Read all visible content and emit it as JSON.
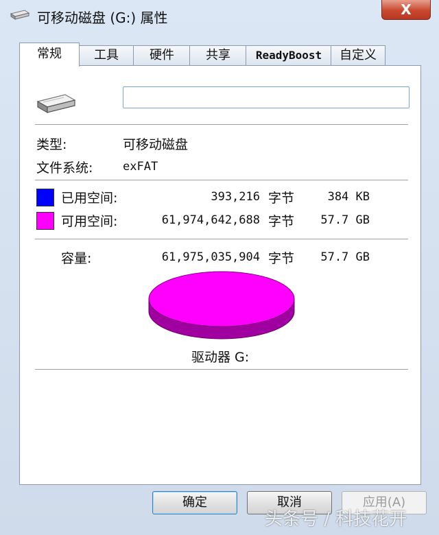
{
  "window": {
    "title": "可移动磁盘 (G:) 属性",
    "close_label": "X"
  },
  "tabs": [
    {
      "label": "常规",
      "active": true
    },
    {
      "label": "工具"
    },
    {
      "label": "硬件"
    },
    {
      "label": "共享"
    },
    {
      "label": "ReadyBoost"
    },
    {
      "label": "自定义"
    }
  ],
  "general": {
    "name_value": "",
    "type_label": "类型:",
    "type_value": "可移动磁盘",
    "fs_label": "文件系统:",
    "fs_value": "exFAT",
    "used": {
      "label": "已用空间:",
      "bytes": "393,216",
      "bytes_unit": "字节",
      "size": "384 KB",
      "color": "#0000ff"
    },
    "free": {
      "label": "可用空间:",
      "bytes": "61,974,642,688",
      "bytes_unit": "字节",
      "size": "57.7 GB",
      "color": "#ff00ff"
    },
    "capacity": {
      "label": "容量:",
      "bytes": "61,975,035,904",
      "bytes_unit": "字节",
      "size": "57.7 GB"
    },
    "drive_label": "驱动器 G:"
  },
  "buttons": {
    "ok": "确定",
    "cancel": "取消",
    "apply": "应用(A)"
  },
  "watermark": "头条号 / 科技花开"
}
